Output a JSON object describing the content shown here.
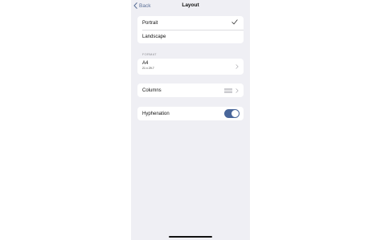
{
  "navbar": {
    "back_label": "Back",
    "title": "Layout"
  },
  "orientation": {
    "options": [
      {
        "label": "Portrait",
        "selected": true
      },
      {
        "label": "Landscape",
        "selected": false
      }
    ]
  },
  "format": {
    "section_label": "FORMAT",
    "name": "A4",
    "size": "21 x 29.7"
  },
  "columns": {
    "label": "Columns"
  },
  "hyphenation": {
    "label": "Hyphenation",
    "enabled": true
  },
  "colors": {
    "accent": "#49669a",
    "background": "#efeff4"
  },
  "icons": [
    "chevron-left-icon",
    "checkmark-icon",
    "chevron-right-icon",
    "columns-icon"
  ]
}
